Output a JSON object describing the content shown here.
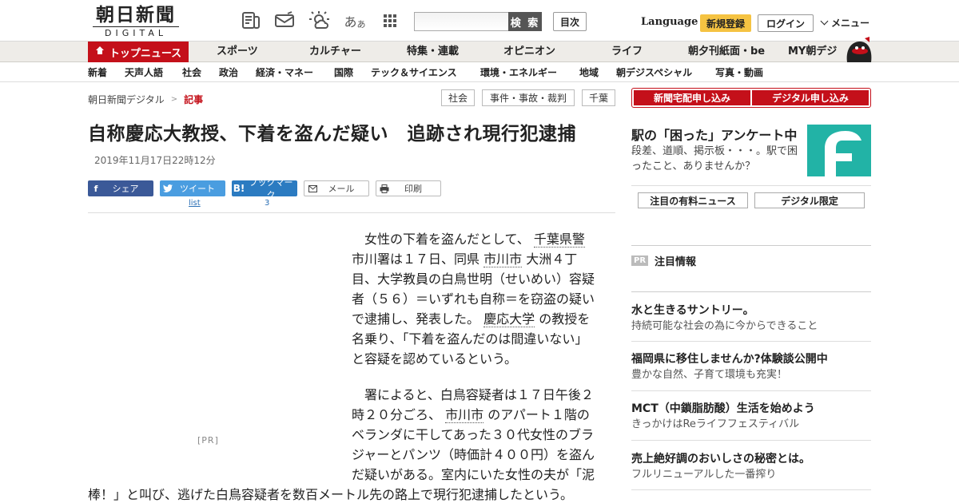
{
  "header": {
    "logo_text": "朝日新聞",
    "logo_sub": "DIGITAL",
    "icons": [
      "paper-icon",
      "mail-icon",
      "weather-icon",
      "font-size-icon",
      "apps-grid-icon"
    ],
    "font_size_glyph": "あ",
    "font_size_glyph_small": "あ",
    "search_placeholder": "",
    "search_label": "検 索",
    "mokuji_label": "目次",
    "language_label": "Language",
    "register_label": "新規登録",
    "login_label": "ログイン",
    "menu_label": "メニュー"
  },
  "main_nav": {
    "items": [
      {
        "label": "トップニュース"
      },
      {
        "label": "スポーツ"
      },
      {
        "label": "カルチャー"
      },
      {
        "label": "特集・連載"
      },
      {
        "label": "オピニオン"
      },
      {
        "label": "ライフ"
      },
      {
        "label": "朝夕刊紙面・be"
      },
      {
        "label": "MY朝デジ"
      }
    ]
  },
  "sub_nav": {
    "items": [
      {
        "label": "新着"
      },
      {
        "label": "天声人語"
      },
      {
        "label": "社会"
      },
      {
        "label": "政治"
      },
      {
        "label": "経済・マネー"
      },
      {
        "label": "国際"
      },
      {
        "label": "テック＆サイエンス"
      },
      {
        "label": "環境・エネルギー"
      },
      {
        "label": "地域"
      },
      {
        "label": "朝デジスペシャル"
      },
      {
        "label": "写真・動画"
      }
    ]
  },
  "breadcrumb": {
    "home": "朝日新聞デジタル",
    "separator": ">",
    "current": "記事"
  },
  "tags": [
    "社会",
    "事件・事故・裁判",
    "千葉"
  ],
  "article": {
    "headline": "自称慶応大教授、下着を盗んだ疑い　追跡され現行犯逮捕",
    "date": "2019年11月17日22時12分",
    "share": {
      "facebook": "シェア",
      "twitter": "ツイート",
      "hatena": "ブックマーク",
      "mail": "メール",
      "print": "印刷",
      "twitter_count": "list",
      "hatena_count": "3"
    },
    "pr_label": "[PR]",
    "p1": {
      "indent": "　",
      "t1": "女性の下着を盗んだとして、",
      "l1": "千葉県警",
      "t2": "市川署は１７日、同県",
      "l2": "市川市",
      "t3": "大洲４丁目、大学教員の白鳥世明（せいめい）容疑者（５６）＝いずれも自称＝を窃盗の疑いで逮捕し、発表した。",
      "l3": "慶応大学",
      "t4": "の教授を名乗り、「下着を盗んだのは間違いない」と容疑を認めているという。"
    },
    "p2": {
      "indent": "　",
      "t1": "署によると、白鳥容疑者は１７日午後２時２０分ごろ、",
      "l1": "市川市",
      "t2": "のアパート１階のベランダに干してあった３０代女性のブラジャーとパンツ（時価計４００円）を盗んだ疑いがある。室内にいた女性の夫が「泥",
      "t3": "棒！」と叫び、逃げた白鳥容疑者を数百メートル先の路上で現行犯逮捕したという。"
    }
  },
  "right_col": {
    "cta": [
      "新聞宅配申し込み",
      "デジタル申し込み"
    ],
    "survey_title": "駅の「困った」アンケート中",
    "survey_desc": "段差、道順、掲示板・・・。駅で困ったこと、ありませんか？",
    "tabs": [
      "注目の有料ニュース",
      "デジタル限定"
    ],
    "pr_badge": "PR",
    "pr_header": "注目情報",
    "pr_items": [
      {
        "title": "水と生きるサントリー。",
        "sub": "持続可能な社会の為に今からできること"
      },
      {
        "title": "福岡県に移住しませんか?体験談公開中",
        "sub": "豊かな自然、子育て環境も充実！"
      },
      {
        "title": "MCT（中鎖脂肪酸）生活を始めよう",
        "sub": "きっかけはReライフフェスティバル"
      },
      {
        "title": "売上絶好調のおいしさの秘密とは。",
        "sub": "フルリニューアルした一番搾り"
      }
    ]
  },
  "colors": {
    "brand_red": "#c4101a",
    "accent_yellow": "#f5c342",
    "survey_teal": "#22b3a6"
  }
}
